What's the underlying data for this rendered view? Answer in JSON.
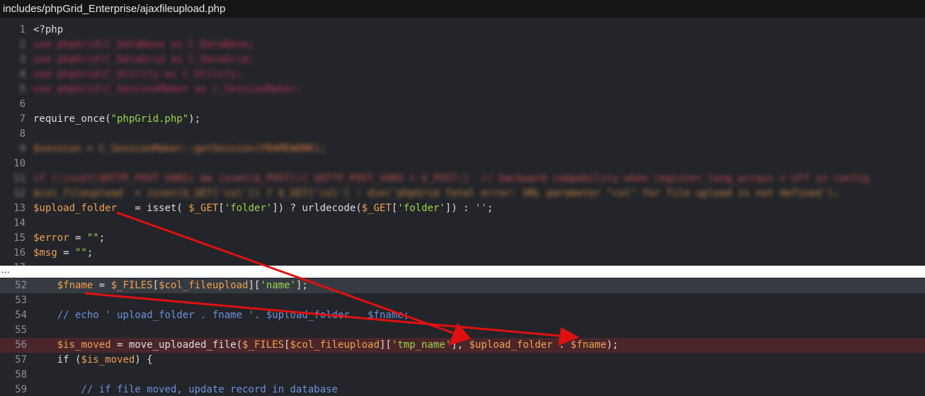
{
  "file_path": "includes/phpGrid_Enterprise/ajaxfileupload.php",
  "ellipsis": "…",
  "top_lines": [
    {
      "n": "1",
      "code": "<?php"
    },
    {
      "n": "2",
      "code": "use phpGrid\\C_DataBase as C_DataBase;"
    },
    {
      "n": "3",
      "code": "use phpGrid\\C_DataGrid as C_DataGrid;"
    },
    {
      "n": "4",
      "code": "use phpGrid\\C_Utility as C_Utility;"
    },
    {
      "n": "5",
      "code": "use phpGrid\\C_SessionMaker as C_SessionMaker;"
    },
    {
      "n": "6",
      "code": ""
    },
    {
      "n": "7",
      "code": "require_once(\"phpGrid.php\");"
    },
    {
      "n": "8",
      "code": ""
    },
    {
      "n": "9",
      "code": "$session = C_SessionMaker::getSession(FRAMEWORK);"
    },
    {
      "n": "10",
      "code": ""
    },
    {
      "n": "11",
      "code": "if (!isset($HTTP_POST_VARS) && isset($_POST)){ $HTTP_POST_VARS = $_POST;}  // backward compability when register_long_arrays = off in config"
    },
    {
      "n": "12",
      "code": "$col_fileupload  = isset($_GET['col']) ? $_GET['col'] : die('phpGrid fatal error: URL parameter \"col\" for file upload is not defined');"
    },
    {
      "n": "13",
      "code": "$upload_folder   = isset( $_GET['folder']) ? urldecode($_GET['folder']) : '';"
    },
    {
      "n": "14",
      "code": ""
    },
    {
      "n": "15",
      "code": "$error = \"\";"
    },
    {
      "n": "16",
      "code": "$msg = \"\";"
    },
    {
      "n": "17",
      "code": ""
    }
  ],
  "bottom_lines": [
    {
      "n": "52",
      "code": "    $fname = $_FILES[$col_fileupload]['name'];"
    },
    {
      "n": "53",
      "code": ""
    },
    {
      "n": "54",
      "code": "    // echo ' upload_folder . fname '. $upload_folder . $fname;"
    },
    {
      "n": "55",
      "code": ""
    },
    {
      "n": "56",
      "code": "    $is_moved = move_uploaded_file($_FILES[$col_fileupload]['tmp_name'], $upload_folder . $fname);"
    },
    {
      "n": "57",
      "code": "    if ($is_moved) {"
    },
    {
      "n": "58",
      "code": ""
    },
    {
      "n": "59",
      "code": "        // if file moved, update record in database"
    }
  ],
  "colors": {
    "arrow": "#e01010",
    "highlight_line_52": "#363b42",
    "highlight_line_56": "#4a262a"
  }
}
